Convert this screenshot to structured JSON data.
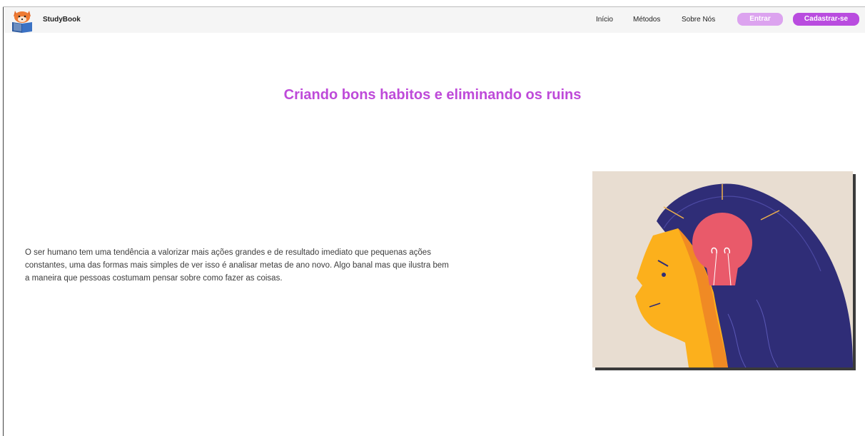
{
  "header": {
    "brand": "StudyBook",
    "nav": [
      "Início",
      "Métodos",
      "Sobre Nós"
    ],
    "login_label": "Entrar",
    "signup_label": "Cadastrar-se"
  },
  "main": {
    "title": "Criando bons habitos e eliminando os ruins",
    "paragraph": "O ser humano tem uma tendência a valorizar mais ações grandes e de resultado imediato que pequenas ações constantes, uma das formas mais simples de ver isso é analisar metas de ano novo. Algo banal mas que ilustra bem a maneira que pessoas costumam pensar sobre como fazer as coisas."
  },
  "colors": {
    "accent": "#be4ad9",
    "button_primary": "#b94cdf",
    "button_secondary": "#dca3ef"
  },
  "icons": {
    "logo": "fox-reading-book-icon",
    "illustration": "woman-head-lightbulb-illustration"
  }
}
